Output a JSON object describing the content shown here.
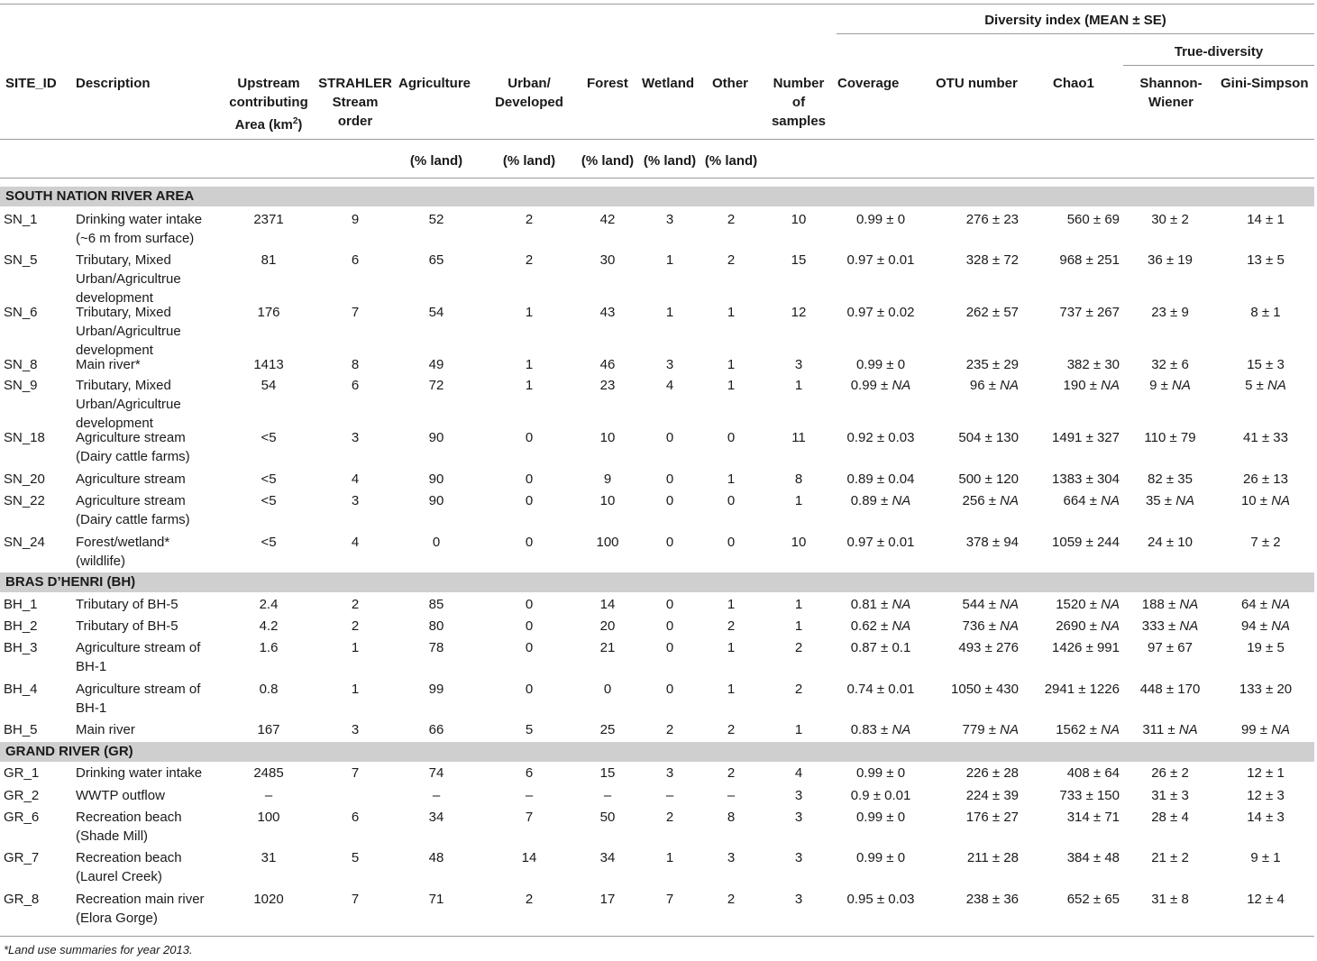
{
  "headers": {
    "group_diversity": "Diversity index (MEAN ± SE)",
    "group_true_diversity": "True-diversity",
    "site_id": "SITE_ID",
    "description": "Description",
    "area_line1": "Upstream",
    "area_line2": "contributing",
    "area_line3": "Area (km",
    "area_sup": "2",
    "area_close": ")",
    "strahler_line1": "STRAHLER",
    "strahler_line2": "Stream",
    "strahler_line3": "order",
    "agriculture": "Agriculture",
    "urban_line1": "Urban/",
    "urban_line2": "Developed",
    "forest": "Forest",
    "wetland": "Wetland",
    "other": "Other",
    "samples_line1": "Number",
    "samples_line2": "of",
    "samples_line3": "samples",
    "coverage": "Coverage",
    "otu": "OTU number",
    "chao1": "Chao1",
    "shannon_line1": "Shannon-",
    "shannon_line2": "Wiener",
    "gini": "Gini-Simpson",
    "unit_land": "(% land)"
  },
  "sections": [
    {
      "title": "SOUTH NATION RIVER AREA",
      "rows": [
        {
          "site": "SN_1",
          "desc": "Drinking water intake (~6 m from surface)",
          "area": "2371",
          "strahler": "9",
          "agri": "52",
          "urban": "2",
          "forest": "42",
          "wetland": "3",
          "other": "2",
          "n": "10",
          "coverage": "0.99 ± 0",
          "otu": "276 ± 23",
          "chao1": "560 ± 69",
          "shannon": "30 ± 2",
          "gini": "14 ± 1"
        },
        {
          "site": "SN_5",
          "desc": "Tributary, Mixed Urban/Agricultrue development",
          "area": "81",
          "strahler": "6",
          "agri": "65",
          "urban": "2",
          "forest": "30",
          "wetland": "1",
          "other": "2",
          "n": "15",
          "coverage": "0.97 ± 0.01",
          "otu": "328 ± 72",
          "chao1": "968 ± 251",
          "shannon": "36 ± 19",
          "gini": "13 ± 5"
        },
        {
          "site": "SN_6",
          "desc": "Tributary, Mixed Urban/Agricultrue development",
          "area": "176",
          "strahler": "7",
          "agri": "54",
          "urban": "1",
          "forest": "43",
          "wetland": "1",
          "other": "1",
          "n": "12",
          "coverage": "0.97 ± 0.02",
          "otu": "262 ± 57",
          "chao1": "737 ± 267",
          "shannon": "23 ± 9",
          "gini": "8 ± 1"
        },
        {
          "site": "SN_8",
          "desc": "Main river*",
          "area": "1413",
          "strahler": "8",
          "agri": "49",
          "urban": "1",
          "forest": "46",
          "wetland": "3",
          "other": "1",
          "n": "3",
          "coverage": "0.99 ± 0",
          "otu": "235 ± 29",
          "chao1": "382 ± 30",
          "shannon": "32 ± 6",
          "gini": "15 ± 3"
        },
        {
          "site": "SN_9",
          "desc": "Tributary, Mixed Urban/Agricultrue development",
          "area": "54",
          "strahler": "6",
          "agri": "72",
          "urban": "1",
          "forest": "23",
          "wetland": "4",
          "other": "1",
          "n": "1",
          "coverage": "0.99 ± NA",
          "otu": "96 ± NA",
          "chao1": "190 ± NA",
          "shannon": "9 ± NA",
          "gini": "5 ± NA"
        },
        {
          "site": "SN_18",
          "desc": "Agriculture stream (Dairy cattle farms)",
          "area": "<5",
          "strahler": "3",
          "agri": "90",
          "urban": "0",
          "forest": "10",
          "wetland": "0",
          "other": "0",
          "n": "11",
          "coverage": "0.92 ± 0.03",
          "otu": "504 ± 130",
          "chao1": "1491 ± 327",
          "shannon": "110 ± 79",
          "gini": "41 ± 33"
        },
        {
          "site": "SN_20",
          "desc": "Agriculture stream",
          "area": "<5",
          "strahler": "4",
          "agri": "90",
          "urban": "0",
          "forest": "9",
          "wetland": "0",
          "other": "1",
          "n": "8",
          "coverage": "0.89 ± 0.04",
          "otu": "500 ± 120",
          "chao1": "1383 ± 304",
          "shannon": "82 ± 35",
          "gini": "26 ± 13"
        },
        {
          "site": "SN_22",
          "desc": "Agriculture stream (Dairy cattle farms)",
          "area": "<5",
          "strahler": "3",
          "agri": "90",
          "urban": "0",
          "forest": "10",
          "wetland": "0",
          "other": "0",
          "n": "1",
          "coverage": "0.89 ± NA",
          "otu": "256 ± NA",
          "chao1": "664 ± NA",
          "shannon": "35 ± NA",
          "gini": "10 ± NA"
        },
        {
          "site": "SN_24",
          "desc": "Forest/wetland* (wildlife)",
          "area": "<5",
          "strahler": "4",
          "agri": "0",
          "urban": "0",
          "forest": "100",
          "wetland": "0",
          "other": "0",
          "n": "10",
          "coverage": "0.97 ± 0.01",
          "otu": "378 ± 94",
          "chao1": "1059 ± 244",
          "shannon": "24 ± 10",
          "gini": "7 ± 2"
        }
      ]
    },
    {
      "title": "BRAS D’HENRI (BH)",
      "rows": [
        {
          "site": "BH_1",
          "desc": "Tributary of BH-5",
          "area": "2.4",
          "strahler": "2",
          "agri": "85",
          "urban": "0",
          "forest": "14",
          "wetland": "0",
          "other": "1",
          "n": "1",
          "coverage": "0.81 ± NA",
          "otu": "544 ± NA",
          "chao1": "1520 ± NA",
          "shannon": "188 ± NA",
          "gini": "64 ± NA"
        },
        {
          "site": "BH_2",
          "desc": "Tributary of BH-5",
          "area": "4.2",
          "strahler": "2",
          "agri": "80",
          "urban": "0",
          "forest": "20",
          "wetland": "0",
          "other": "2",
          "n": "1",
          "coverage": "0.62 ± NA",
          "otu": "736 ± NA",
          "chao1": "2690 ± NA",
          "shannon": "333 ± NA",
          "gini": "94 ± NA"
        },
        {
          "site": "BH_3",
          "desc": "Agriculture stream of BH-1",
          "area": "1.6",
          "strahler": "1",
          "agri": "78",
          "urban": "0",
          "forest": "21",
          "wetland": "0",
          "other": "1",
          "n": "2",
          "coverage": "0.87 ± 0.1",
          "otu": "493 ± 276",
          "chao1": "1426 ± 991",
          "shannon": "97 ± 67",
          "gini": "19 ± 5"
        },
        {
          "site": "BH_4",
          "desc": "Agriculture stream of BH-1",
          "area": "0.8",
          "strahler": "1",
          "agri": "99",
          "urban": "0",
          "forest": "0",
          "wetland": "0",
          "other": "1",
          "n": "2",
          "coverage": "0.74 ± 0.01",
          "otu": "1050 ± 430",
          "chao1": "2941 ± 1226",
          "shannon": "448 ± 170",
          "gini": "133 ± 20"
        },
        {
          "site": "BH_5",
          "desc": "Main river",
          "area": "167",
          "strahler": "3",
          "agri": "66",
          "urban": "5",
          "forest": "25",
          "wetland": "2",
          "other": "2",
          "n": "1",
          "coverage": "0.83 ± NA",
          "otu": "779 ± NA",
          "chao1": "1562 ± NA",
          "shannon": "311 ± NA",
          "gini": "99 ± NA"
        }
      ]
    },
    {
      "title": "GRAND RIVER (GR)",
      "rows": [
        {
          "site": "GR_1",
          "desc": "Drinking water intake",
          "area": "2485",
          "strahler": "7",
          "agri": "74",
          "urban": "6",
          "forest": "15",
          "wetland": "3",
          "other": "2",
          "n": "4",
          "coverage": "0.99 ± 0",
          "otu": "226 ± 28",
          "chao1": "408 ± 64",
          "shannon": "26 ± 2",
          "gini": "12 ± 1"
        },
        {
          "site": "GR_2",
          "desc": "WWTP outflow",
          "area": "–",
          "strahler": "",
          "agri": "–",
          "urban": "–",
          "forest": "–",
          "wetland": "–",
          "other": "–",
          "n": "3",
          "coverage": "0.9 ± 0.01",
          "otu": "224 ± 39",
          "chao1": "733 ± 150",
          "shannon": "31 ± 3",
          "gini": "12 ± 3"
        },
        {
          "site": "GR_6",
          "desc": "Recreation beach (Shade Mill)",
          "area": "100",
          "strahler": "6",
          "agri": "34",
          "urban": "7",
          "forest": "50",
          "wetland": "2",
          "other": "8",
          "n": "3",
          "coverage": "0.99 ± 0",
          "otu": "176 ± 27",
          "chao1": "314 ± 71",
          "shannon": "28 ± 4",
          "gini": "14 ± 3"
        },
        {
          "site": "GR_7",
          "desc": "Recreation beach (Laurel Creek)",
          "area": "31",
          "strahler": "5",
          "agri": "48",
          "urban": "14",
          "forest": "34",
          "wetland": "1",
          "other": "3",
          "n": "3",
          "coverage": "0.99 ± 0",
          "otu": "211 ± 28",
          "chao1": "384 ± 48",
          "shannon": "21 ± 2",
          "gini": "9 ± 1"
        },
        {
          "site": "GR_8",
          "desc": "Recreation main river (Elora Gorge)",
          "area": "1020",
          "strahler": "7",
          "agri": "71",
          "urban": "2",
          "forest": "17",
          "wetland": "7",
          "other": "2",
          "n": "3",
          "coverage": "0.95 ± 0.03",
          "otu": "238 ± 36",
          "chao1": "652 ± 65",
          "shannon": "31 ± 8",
          "gini": "12 ± 4"
        }
      ]
    }
  ],
  "footnote": "*Land use summaries for year 2013."
}
